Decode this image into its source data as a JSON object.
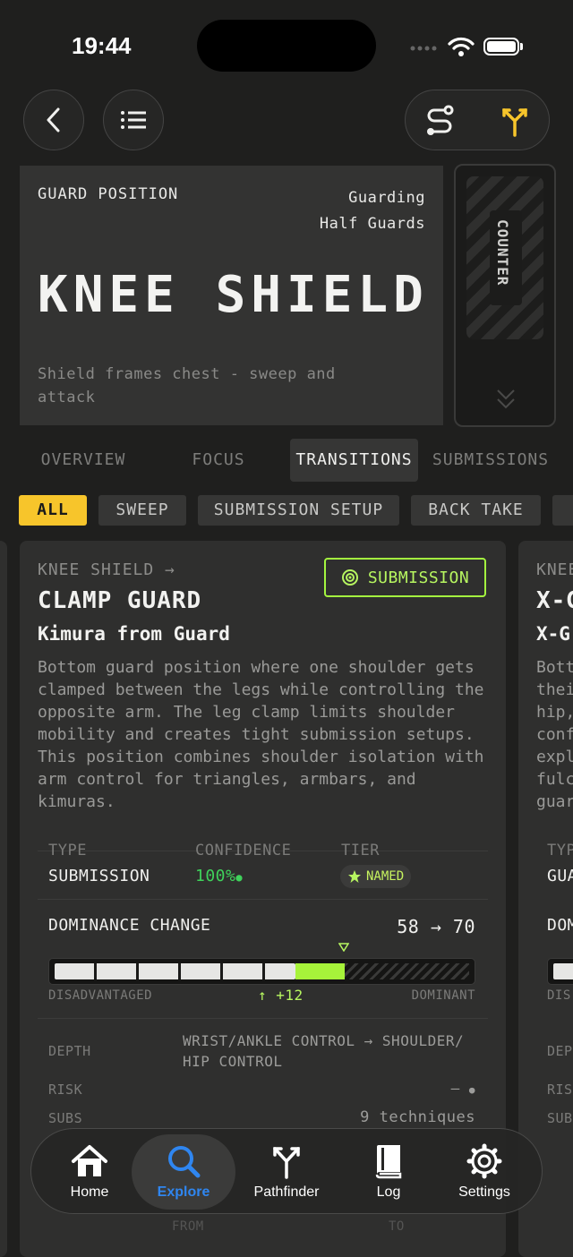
{
  "status": {
    "time": "19:44"
  },
  "header": {
    "label": "GUARD POSITION",
    "category_line1": "Guarding",
    "category_line2": "Half Guards",
    "title": "KNEE SHIELD",
    "description": "Shield frames chest - sweep and attack",
    "counter_label": "COUNTER"
  },
  "tabs": [
    "OVERVIEW",
    "FOCUS",
    "TRANSITIONS",
    "SUBMISSIONS"
  ],
  "active_tab": "TRANSITIONS",
  "filters": [
    "ALL",
    "SWEEP",
    "SUBMISSION SETUP",
    "BACK TAKE"
  ],
  "card": {
    "from": "KNEE SHIELD →",
    "badge": "SUBMISSION",
    "title": "CLAMP GUARD",
    "subtitle": "Kimura from Guard",
    "description": "Bottom guard position where one shoulder gets clamped between the legs while controlling the opposite arm. The leg clamp limits shoulder mobility and creates tight submission setups. This position combines shoulder isolation with arm control for triangles, armbars, and kimuras.",
    "type_label": "TYPE",
    "type_value": "SUBMISSION",
    "confidence_label": "CONFIDENCE",
    "confidence_value": "100%",
    "tier_label": "TIER",
    "tier_value": "NAMED",
    "dominance_label": "DOMINANCE CHANGE",
    "dominance_value": "58 → 70",
    "dominance_from": 58,
    "dominance_to": 70,
    "scale_left": "DISADVANTAGED",
    "scale_right": "DOMINANT",
    "delta": "↑ +12",
    "depth_label": "DEPTH",
    "depth_value": "WRIST/ANKLE CONTROL → SHOULDER/ HIP CONTROL",
    "risk_label": "RISK",
    "risk_value": "—",
    "subs_label": "SUBS",
    "subs_value": "9 techniques",
    "footer_from": "FROM",
    "footer_to": "TO"
  },
  "next_card": {
    "from": "KNEE",
    "title": "X-G",
    "subtitle": "X-G",
    "lines": [
      "Bott",
      "thei",
      "hip,",
      "conf",
      "expl",
      "fulc",
      "guar"
    ],
    "type_label": "TYP",
    "type_value": "GUA",
    "dominance_label": "DOM",
    "scale_left": "DIS",
    "depth_label": "DEP",
    "risk_label": "RIS",
    "subs_label": "SUB"
  },
  "nav": {
    "items": [
      "Home",
      "Explore",
      "Pathfinder",
      "Log",
      "Settings"
    ],
    "active": "Explore"
  },
  "colors": {
    "accent_yellow": "#f7c52b",
    "accent_green": "#a7f33a",
    "confidence_green": "#3fd25b",
    "active_nav_blue": "#2f86f0"
  }
}
